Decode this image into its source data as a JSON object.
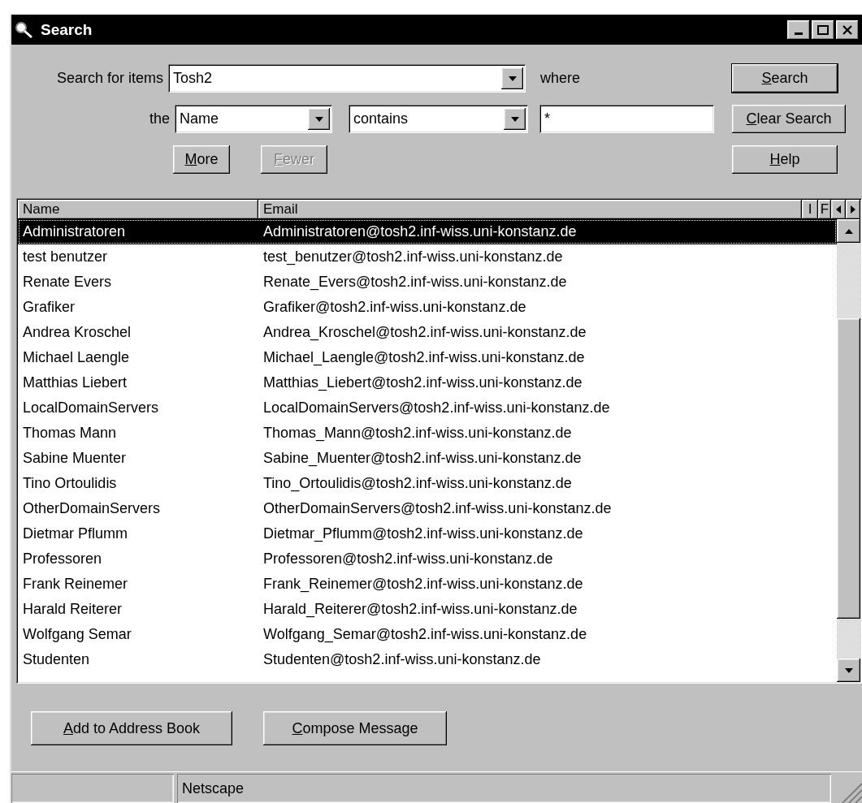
{
  "window": {
    "title": "Search"
  },
  "search": {
    "label": "Search for items",
    "scope": "Tosh2",
    "where_label": "where",
    "the_label": "the",
    "field": "Name",
    "operator": "contains",
    "value": "*"
  },
  "buttons": [
    {
      "label": "Search",
      "kind": "default",
      "disabled": false
    },
    {
      "label": "Clear Search",
      "kind": "normal",
      "disabled": false
    },
    {
      "label": "More",
      "kind": "normal",
      "disabled": false
    },
    {
      "label": "Fewer",
      "kind": "normal",
      "disabled": true
    },
    {
      "label": "Help",
      "kind": "normal",
      "disabled": false
    }
  ],
  "table": {
    "columns": [
      "Name",
      "Email",
      "I",
      "F"
    ],
    "rows": [
      {
        "name": "Administratoren",
        "email": "Administratoren@tosh2.inf-wiss.uni-konstanz.de",
        "selected": true
      },
      {
        "name": "test benutzer",
        "email": "test_benutzer@tosh2.inf-wiss.uni-konstanz.de",
        "selected": false
      },
      {
        "name": "Renate Evers",
        "email": "Renate_Evers@tosh2.inf-wiss.uni-konstanz.de",
        "selected": false
      },
      {
        "name": "Grafiker",
        "email": "Grafiker@tosh2.inf-wiss.uni-konstanz.de",
        "selected": false
      },
      {
        "name": "Andrea Kroschel",
        "email": "Andrea_Kroschel@tosh2.inf-wiss.uni-konstanz.de",
        "selected": false
      },
      {
        "name": "Michael Laengle",
        "email": "Michael_Laengle@tosh2.inf-wiss.uni-konstanz.de",
        "selected": false
      },
      {
        "name": "Matthias Liebert",
        "email": "Matthias_Liebert@tosh2.inf-wiss.uni-konstanz.de",
        "selected": false
      },
      {
        "name": "LocalDomainServers",
        "email": "LocalDomainServers@tosh2.inf-wiss.uni-konstanz.de",
        "selected": false
      },
      {
        "name": "Thomas Mann",
        "email": "Thomas_Mann@tosh2.inf-wiss.uni-konstanz.de",
        "selected": false
      },
      {
        "name": "Sabine Muenter",
        "email": "Sabine_Muenter@tosh2.inf-wiss.uni-konstanz.de",
        "selected": false
      },
      {
        "name": "Tino Ortoulidis",
        "email": "Tino_Ortoulidis@tosh2.inf-wiss.uni-konstanz.de",
        "selected": false
      },
      {
        "name": "OtherDomainServers",
        "email": "OtherDomainServers@tosh2.inf-wiss.uni-konstanz.de",
        "selected": false
      },
      {
        "name": "Dietmar Pflumm",
        "email": "Dietmar_Pflumm@tosh2.inf-wiss.uni-konstanz.de",
        "selected": false
      },
      {
        "name": "Professoren",
        "email": "Professoren@tosh2.inf-wiss.uni-konstanz.de",
        "selected": false
      },
      {
        "name": "Frank Reinemer",
        "email": "Frank_Reinemer@tosh2.inf-wiss.uni-konstanz.de",
        "selected": false
      },
      {
        "name": "Harald Reiterer",
        "email": "Harald_Reiterer@tosh2.inf-wiss.uni-konstanz.de",
        "selected": false
      },
      {
        "name": "Wolfgang Semar",
        "email": "Wolfgang_Semar@tosh2.inf-wiss.uni-konstanz.de",
        "selected": false
      },
      {
        "name": "Studenten",
        "email": "Studenten@tosh2.inf-wiss.uni-konstanz.de",
        "selected": false
      }
    ]
  },
  "actions": [
    "Add to Address Book",
    "Compose Message"
  ],
  "status_bar": {
    "panel_2": "Netscape"
  }
}
